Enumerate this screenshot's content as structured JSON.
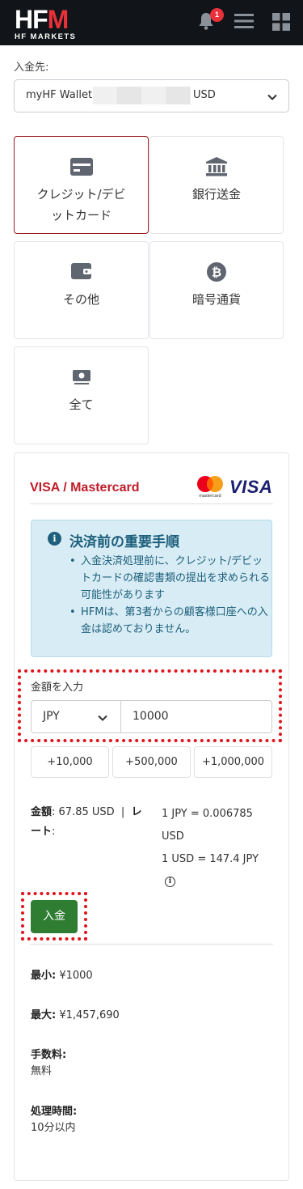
{
  "header": {
    "logo_main": "HF",
    "logo_m": "M",
    "logo_sub": "HF MARKETS",
    "notification_count": "1"
  },
  "destination": {
    "label": "入金先:",
    "wallet_prefix": "myHF Wallet:",
    "currency": "USD"
  },
  "methods": [
    {
      "label": "クレジット/デビットカード",
      "line1": "クレジット/デビ",
      "line2": "ットカード",
      "icon": "credit-card-icon",
      "active": true
    },
    {
      "label": "銀行送金",
      "icon": "bank-icon",
      "active": false
    },
    {
      "label": "その他",
      "icon": "wallet-icon",
      "active": false
    },
    {
      "label": "暗号通貨",
      "icon": "bitcoin-icon",
      "active": false
    },
    {
      "label": "全て",
      "icon": "cash-icon",
      "active": false
    }
  ],
  "panel": {
    "title": "VISA / Mastercard",
    "mastercard_text": "mastercard",
    "visa_text": "VISA",
    "notice": {
      "icon_text": "i",
      "title": "決済前の重要手順",
      "items": [
        "入金決済処理前に、クレジット/デビットカードの確認書類の提出を求められる可能性があります",
        "HFMは、第3者からの顧客様口座への入金は認めておりません。"
      ]
    },
    "amount_label": "金額を入力",
    "currency_value": "JPY",
    "amount_value": "10000",
    "quick_amounts": [
      "+10,000",
      "+500,000",
      "+1,000,000"
    ],
    "summary": {
      "amount_key": "金額",
      "amount_value": ": 67.85 USD",
      "separator": "|",
      "rate_key": "レート",
      "rate_line1": "1 JPY = 0.006785 USD",
      "rate_line2": "1 USD = 147.4 JPY",
      "info_text": "i"
    },
    "deposit_button": "入金",
    "limits": {
      "min_key": "最小:",
      "min_value": "¥1000",
      "max_key": "最大:",
      "max_value": "¥1,457,690",
      "fee_key": "手数料:",
      "fee_value": "無料",
      "time_key": "処理時間:",
      "time_value": "10分以内"
    }
  },
  "colors": {
    "header_bg": "#111418",
    "brand_red": "#e8313a",
    "active_border": "#9b1b22",
    "title_red": "#c01c28",
    "notice_bg": "#d7ecf4",
    "notice_text": "#1d5f7c",
    "deposit_green": "#2e7d32",
    "highlight_red": "#e0141b"
  }
}
